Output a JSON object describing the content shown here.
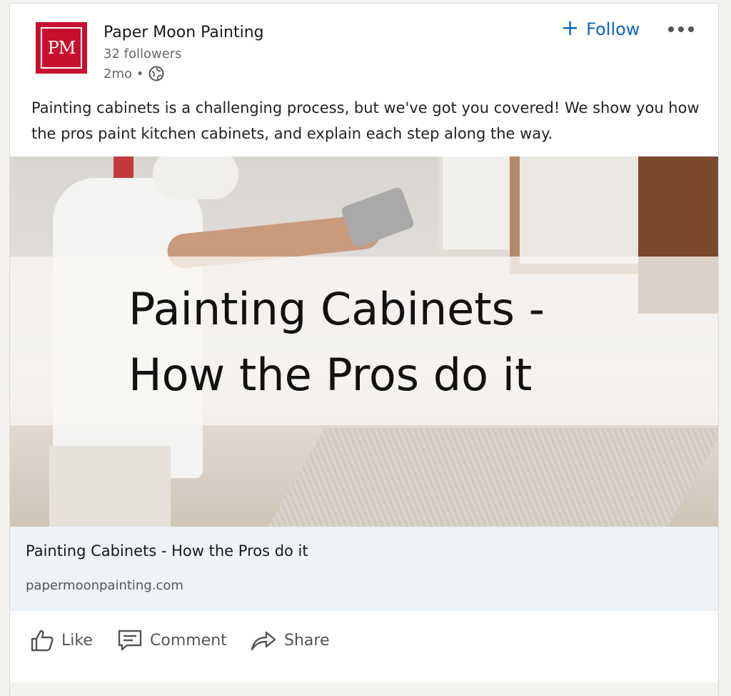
{
  "author": {
    "logo_text": "PM",
    "name": "Paper Moon Painting",
    "followers": "32 followers",
    "time": "2mo •"
  },
  "header_actions": {
    "follow_label": "Follow"
  },
  "post": {
    "text": "Painting cabinets is a challenging process, but we've got you covered! We show you how the pros paint kitchen cabinets, and explain each step along the way."
  },
  "image": {
    "overlay_title_line1": "Painting Cabinets -",
    "overlay_title_line2": "How the Pros do it"
  },
  "link_preview": {
    "title": "Painting Cabinets - How the Pros do it",
    "domain": "papermoonpainting.com"
  },
  "actions": {
    "like": "Like",
    "comment": "Comment",
    "share": "Share"
  },
  "icons": {
    "globe": "globe-icon",
    "more": "more-icon",
    "like": "thumbs-up-icon",
    "comment": "comment-icon",
    "share": "share-icon"
  },
  "colors": {
    "accent": "#0a66c2",
    "logo_bg": "#c8102e",
    "link_bg": "#eef3f8"
  }
}
